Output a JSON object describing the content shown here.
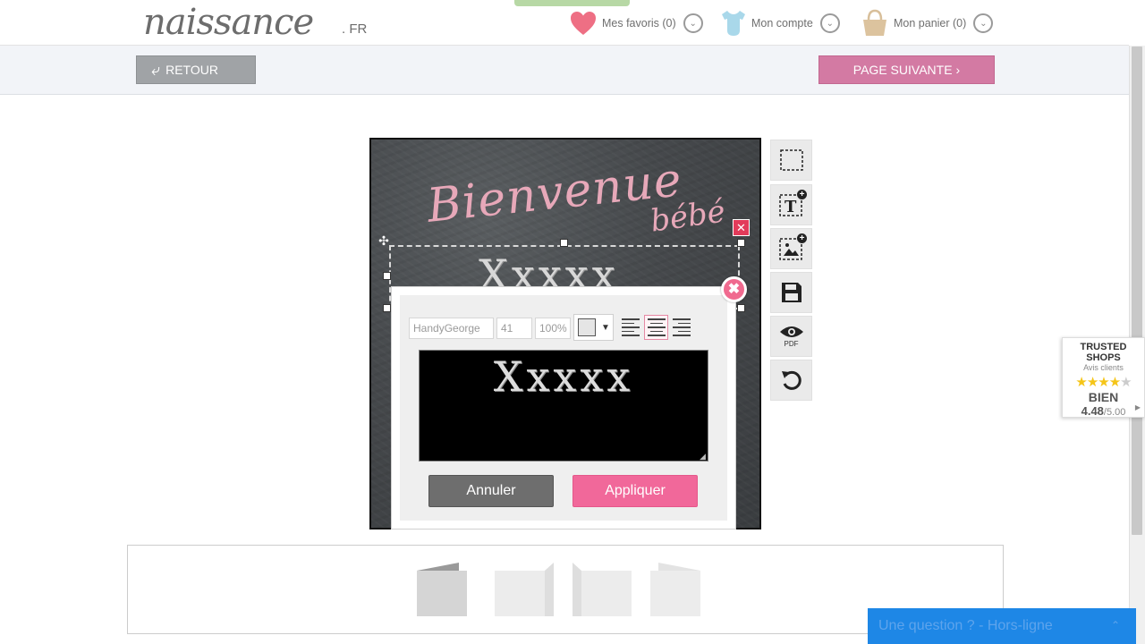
{
  "header": {
    "logo": "naissance",
    "logo_suffix": ". FR",
    "favorites": "Mes favoris (0)",
    "account": "Mon compte",
    "cart": "Mon panier (0)"
  },
  "nav": {
    "back": "RETOUR",
    "next": "PAGE SUIVANTE"
  },
  "card": {
    "script_title": "Bienvenue",
    "script_sub": "bébé",
    "text": "Xxxxx"
  },
  "editor": {
    "font": "HandyGeorge",
    "size": "41",
    "scale": "100%",
    "text": "Xxxxx",
    "cancel": "Annuler",
    "apply": "Appliquer"
  },
  "tools": {
    "pdf_label": "PDF"
  },
  "trusted": {
    "title": "TRUSTED SHOPS",
    "subtitle": "Avis clients",
    "rating_word": "BIEN",
    "score": "4.48",
    "max": "/5.00",
    "stars": 4.48
  },
  "chat": {
    "label": "Une question ? - Hors-ligne"
  },
  "colors": {
    "accent_pink": "#f1689a",
    "next_button": "#d37aa3",
    "back_button": "#a0a3a6",
    "chat_blue": "#1e87e6"
  }
}
